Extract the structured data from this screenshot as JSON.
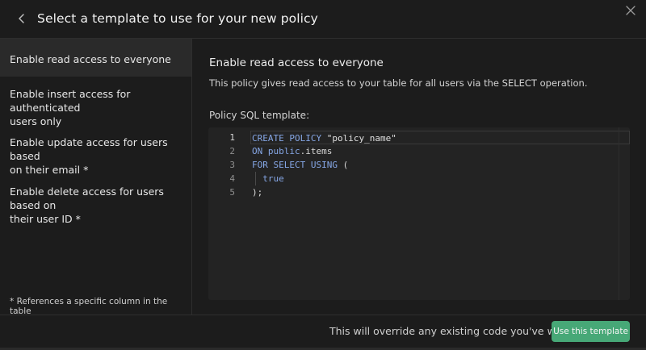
{
  "header": {
    "title": "Select a template to use for your new policy",
    "back_icon": "chevron-left-icon",
    "close_icon": "close-icon"
  },
  "sidebar": {
    "items": [
      {
        "lines": [
          "Enable read access to everyone"
        ],
        "active": true
      },
      {
        "lines": [
          "Enable insert access for authenticated",
          "users only"
        ],
        "active": false
      },
      {
        "lines": [
          "Enable update access for users based",
          "on their email *"
        ],
        "active": false
      },
      {
        "lines": [
          "Enable delete access for users based on",
          "their user ID *"
        ],
        "active": false
      }
    ],
    "footnote": "* References a specific column in the table"
  },
  "content": {
    "title": "Enable read access to everyone",
    "description": "This policy gives read access to your table for all users via the SELECT operation.",
    "sql_label": "Policy SQL template:",
    "sql_lines": [
      {
        "num": "1",
        "code": "CREATE POLICY \"policy_name\""
      },
      {
        "num": "2",
        "code": "ON public.items"
      },
      {
        "num": "3",
        "code": "FOR SELECT USING ("
      },
      {
        "num": "4",
        "code": "  true"
      },
      {
        "num": "5",
        "code": ");"
      }
    ]
  },
  "footer": {
    "override_text": "This will override any existing code you've written",
    "use_button": "Use this template"
  },
  "colors": {
    "background": "#1c1c1c",
    "active_item": "#2a2a2a",
    "keyword": "#86a7e6",
    "primary_button": "#47a877"
  }
}
